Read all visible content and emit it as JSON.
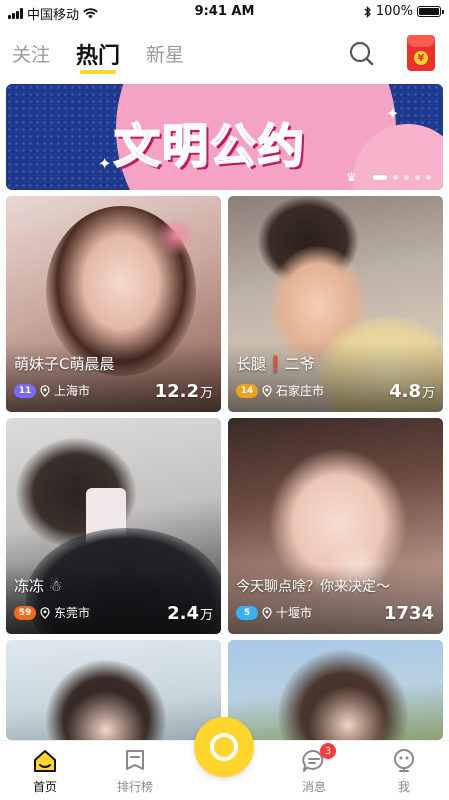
{
  "status_bar": {
    "carrier": "中国移动",
    "time": "9:41 AM",
    "battery": "100%"
  },
  "top_nav": {
    "tabs": [
      {
        "label": "关注"
      },
      {
        "label": "热门",
        "active": true
      },
      {
        "label": "新星"
      }
    ],
    "search_icon": "search-icon",
    "red_packet_icon": "red-packet-icon",
    "red_packet_symbol": "¥"
  },
  "banner": {
    "title": "文明公约",
    "pages": 5,
    "active_page": 1
  },
  "cards": [
    {
      "name": "萌妹子C萌晨晨",
      "level": "11",
      "location": "上海市",
      "count": "12.2",
      "unit": "万",
      "badge_color": "#7c6cf0"
    },
    {
      "name": "长腿",
      "name_suffix": "二爷",
      "level": "14",
      "location": "石家庄市",
      "count": "4.8",
      "unit": "万",
      "badge_color": "#f0a020"
    },
    {
      "name": "冻冻",
      "level": "59",
      "location": "东莞市",
      "count": "2.4",
      "unit": "万",
      "badge_color": "#f06a20"
    },
    {
      "name": "今天聊点啥？你来决定～",
      "level": "5",
      "location": "十堰市",
      "count": "1734",
      "unit": "",
      "badge_color": "#3ab0f0"
    }
  ],
  "bottom_nav": {
    "items": [
      {
        "label": "首页",
        "active": true,
        "icon": "home-icon"
      },
      {
        "label": "排行榜",
        "icon": "ranking-icon"
      },
      {
        "label": "消息",
        "icon": "message-icon",
        "badge": "3"
      },
      {
        "label": "我",
        "icon": "profile-icon"
      }
    ],
    "center_icon": "live-camera-icon"
  },
  "colors": {
    "accent": "#ffd52e",
    "red": "#e8322b"
  }
}
